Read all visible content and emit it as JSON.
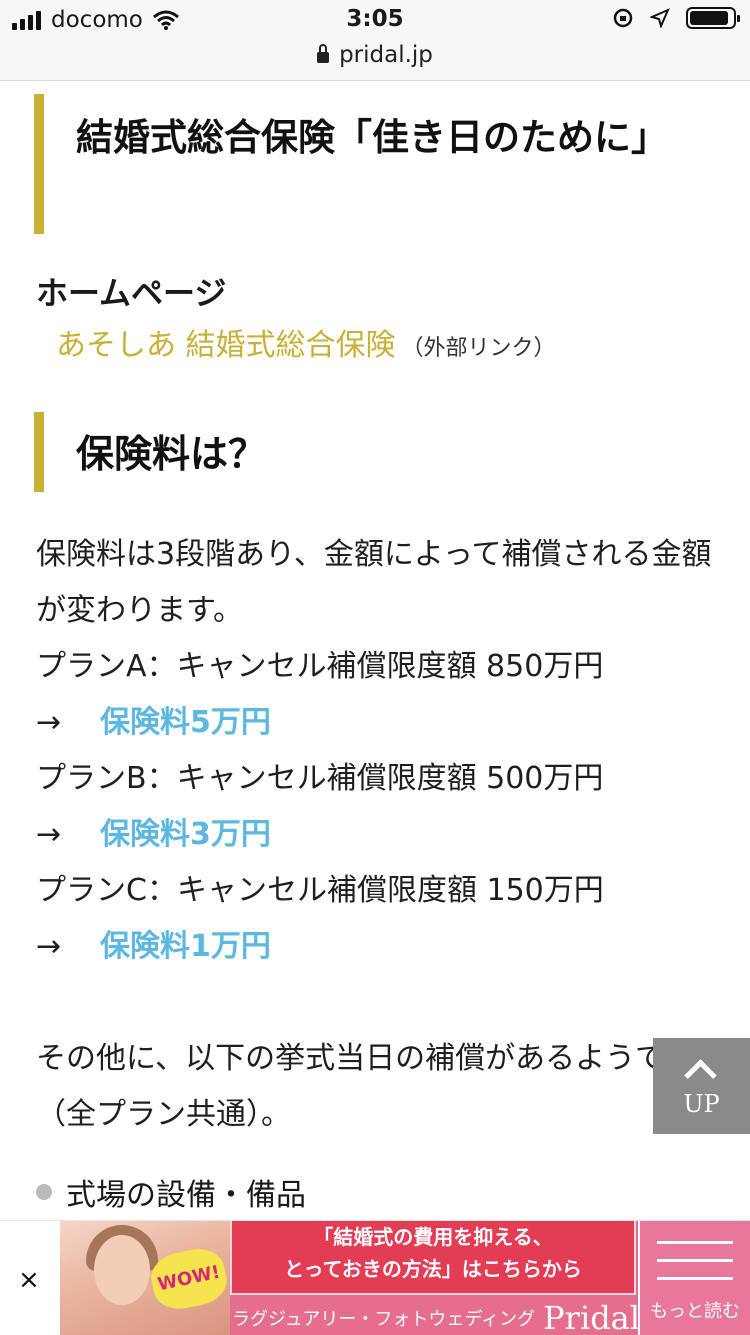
{
  "status_bar": {
    "carrier": "docomo",
    "time": "3:05",
    "icons": [
      "signal-icon",
      "wifi-icon",
      "orientation-lock-icon",
      "location-icon",
      "battery-icon"
    ],
    "battery_level": 0.9
  },
  "url_bar": {
    "url": "pridal.jp",
    "icon": "lock-icon"
  },
  "article": {
    "section_title": "結婚式総合保険「佳き日のために」",
    "homepage_label": "ホームページ",
    "homepage_link": "あそしあ 結婚式総合保険",
    "homepage_link_note": "（外部リンク）",
    "premium_heading": "保険料は？",
    "intro": "保険料は3段階あり、金額によって補償される金額が変わります。",
    "plans": [
      {
        "line": "プランA：キャンセル補償限度額 850万円",
        "arrow": "→",
        "premium": "保険料5万円"
      },
      {
        "line": "プランB：キャンセル補償限度額 500万円",
        "arrow": "→",
        "premium": "保険料3万円"
      },
      {
        "line": "プランC：キャンセル補償限度額 150万円",
        "arrow": "→",
        "premium": "保険料1万円"
      }
    ],
    "other_note": "その他に、以下の挙式当日の補償があるようです（全プラン共通）。",
    "bullets": [
      "式場の設備・備品"
    ]
  },
  "up_button": {
    "label": "UP"
  },
  "ad": {
    "close": "×",
    "badge": "WOW!",
    "headline_1": "「結婚式の費用を抑える、",
    "headline_2": "とっておきの方法」はこちらから",
    "brand_sub": "ラグジュアリー・フォトウェディング",
    "brand_logo": "Pridal",
    "more": "もっと読む"
  },
  "colors": {
    "accent": "#c9b037",
    "premium_text": "#5cb8e0",
    "ad_pink": "#e56e8e",
    "ad_red": "#e23d55"
  }
}
